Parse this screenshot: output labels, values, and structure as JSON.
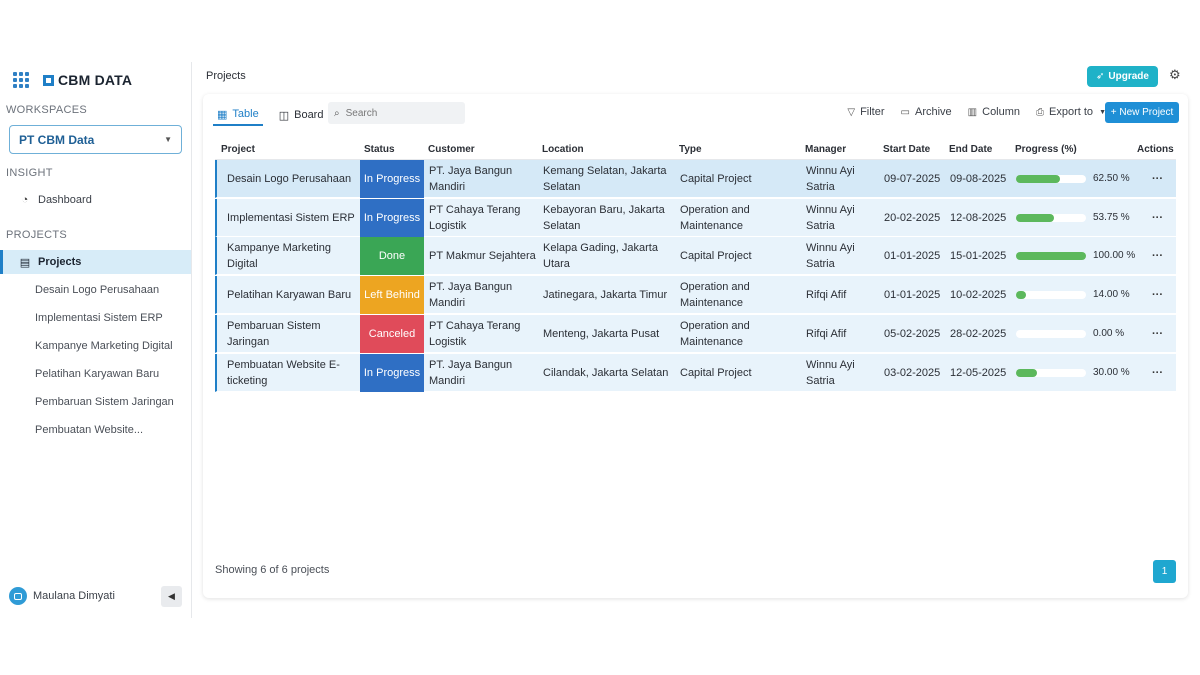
{
  "brand": {
    "name": "CBM DATA"
  },
  "sidebar": {
    "workspaces_label": "WORKSPACES",
    "workspace_selected": "PT CBM Data",
    "insight_label": "INSIGHT",
    "dashboard_label": "Dashboard",
    "projects_label": "PROJECTS",
    "projects_item": "Projects",
    "sub_items": [
      "Desain Logo Perusahaan",
      "Implementasi Sistem ERP",
      "Kampanye Marketing Digital",
      "Pelatihan Karyawan Baru",
      "Pembaruan Sistem Jaringan",
      "Pembuatan Website..."
    ],
    "user_name": "Maulana Dimyati"
  },
  "header": {
    "title": "Projects",
    "upgrade_label": "Upgrade"
  },
  "toolbar": {
    "tabs": [
      "Table",
      "Board"
    ],
    "search_placeholder": "Search",
    "filter": "Filter",
    "archive": "Archive",
    "column": "Column",
    "export": "Export to",
    "new_project": "+ New Project"
  },
  "table": {
    "columns": [
      "Project",
      "Status",
      "Customer",
      "Location",
      "Type",
      "Manager",
      "Start Date",
      "End Date",
      "Progress (%)",
      "Actions"
    ],
    "rows": [
      {
        "project": "Desain Logo Perusahaan",
        "status": "In Progress",
        "status_color": "#2f6fc4",
        "customer": "PT. Jaya Bangun Mandiri",
        "location": "Kemang Selatan, Jakarta Selatan",
        "type": "Capital Project",
        "manager": "Winnu Ayi Satria",
        "start": "09-07-2025",
        "end": "09-08-2025",
        "progress": 0.625,
        "progress_text": "62.50 %"
      },
      {
        "project": "Implementasi Sistem ERP",
        "status": "In Progress",
        "status_color": "#2f6fc4",
        "customer": "PT Cahaya Terang Logistik",
        "location": "Kebayoran Baru, Jakarta Selatan",
        "type": "Operation and Maintenance",
        "manager": "Winnu Ayi Satria",
        "start": "20-02-2025",
        "end": "12-08-2025",
        "progress": 0.5375,
        "progress_text": "53.75 %"
      },
      {
        "project": "Kampanye Marketing Digital",
        "status": "Done",
        "status_color": "#3aa655",
        "customer": "PT Makmur Sejahtera",
        "location": "Kelapa Gading, Jakarta Utara",
        "type": "Capital Project",
        "manager": "Winnu Ayi Satria",
        "start": "01-01-2025",
        "end": "15-01-2025",
        "progress": 1.0,
        "progress_text": "100.00 %"
      },
      {
        "project": "Pelatihan Karyawan Baru",
        "status": "Left Behind",
        "status_color": "#eda521",
        "customer": "PT. Jaya Bangun Mandiri",
        "location": "Jatinegara, Jakarta Timur",
        "type": "Operation and Maintenance",
        "manager": "Rifqi Afif",
        "start": "01-01-2025",
        "end": "10-02-2025",
        "progress": 0.14,
        "progress_text": "14.00 %"
      },
      {
        "project": "Pembaruan Sistem Jaringan",
        "status": "Canceled",
        "status_color": "#e04b5a",
        "customer": "PT Cahaya Terang Logistik",
        "location": "Menteng, Jakarta Pusat",
        "type": "Operation and Maintenance",
        "manager": "Rifqi Afif",
        "start": "05-02-2025",
        "end": "28-02-2025",
        "progress": 0.0,
        "progress_text": "0.00 %"
      },
      {
        "project": "Pembuatan Website E-ticketing",
        "status": "In Progress",
        "status_color": "#2f6fc4",
        "customer": "PT. Jaya Bangun Mandiri",
        "location": "Cilandak, Jakarta Selatan",
        "type": "Capital Project",
        "manager": "Winnu Ayi Satria",
        "start": "03-02-2025",
        "end": "12-05-2025",
        "progress": 0.3,
        "progress_text": "30.00 %"
      }
    ],
    "actions_glyph": "···"
  },
  "footer": {
    "showing": "Showing 6 of 6 projects",
    "page": "1"
  }
}
